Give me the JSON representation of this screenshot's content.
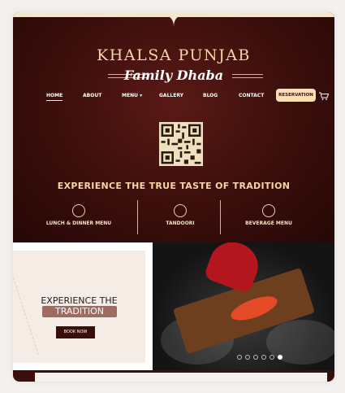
{
  "brand": {
    "name": "Khalsa Punjab",
    "tagline": "Family Dhaba"
  },
  "nav": {
    "items": [
      {
        "label": "HOME",
        "active": true
      },
      {
        "label": "ABOUT"
      },
      {
        "label": "MENU"
      },
      {
        "label": "GALLERY"
      },
      {
        "label": "BLOG"
      },
      {
        "label": "CONTACT"
      }
    ],
    "reservation": "RESERVATION"
  },
  "hero": {
    "headline": "EXPERIENCE THE TRUE TASTE OF TRADITION",
    "categories": [
      {
        "label": "LUNCH & DINNER MENU"
      },
      {
        "label": "TANDOORI"
      },
      {
        "label": "BEVERAGE MENU"
      }
    ]
  },
  "promo": {
    "title_top": "EXPERIENCE THE",
    "title_bottom": "TRADITION",
    "button": "BOOK NOW"
  },
  "carousel": {
    "slides": 6,
    "active": 6
  },
  "colors": {
    "hero_bg": "#3a0e0b",
    "accent": "#f4d7a9",
    "reservation_bg": "#f9e0b4"
  }
}
